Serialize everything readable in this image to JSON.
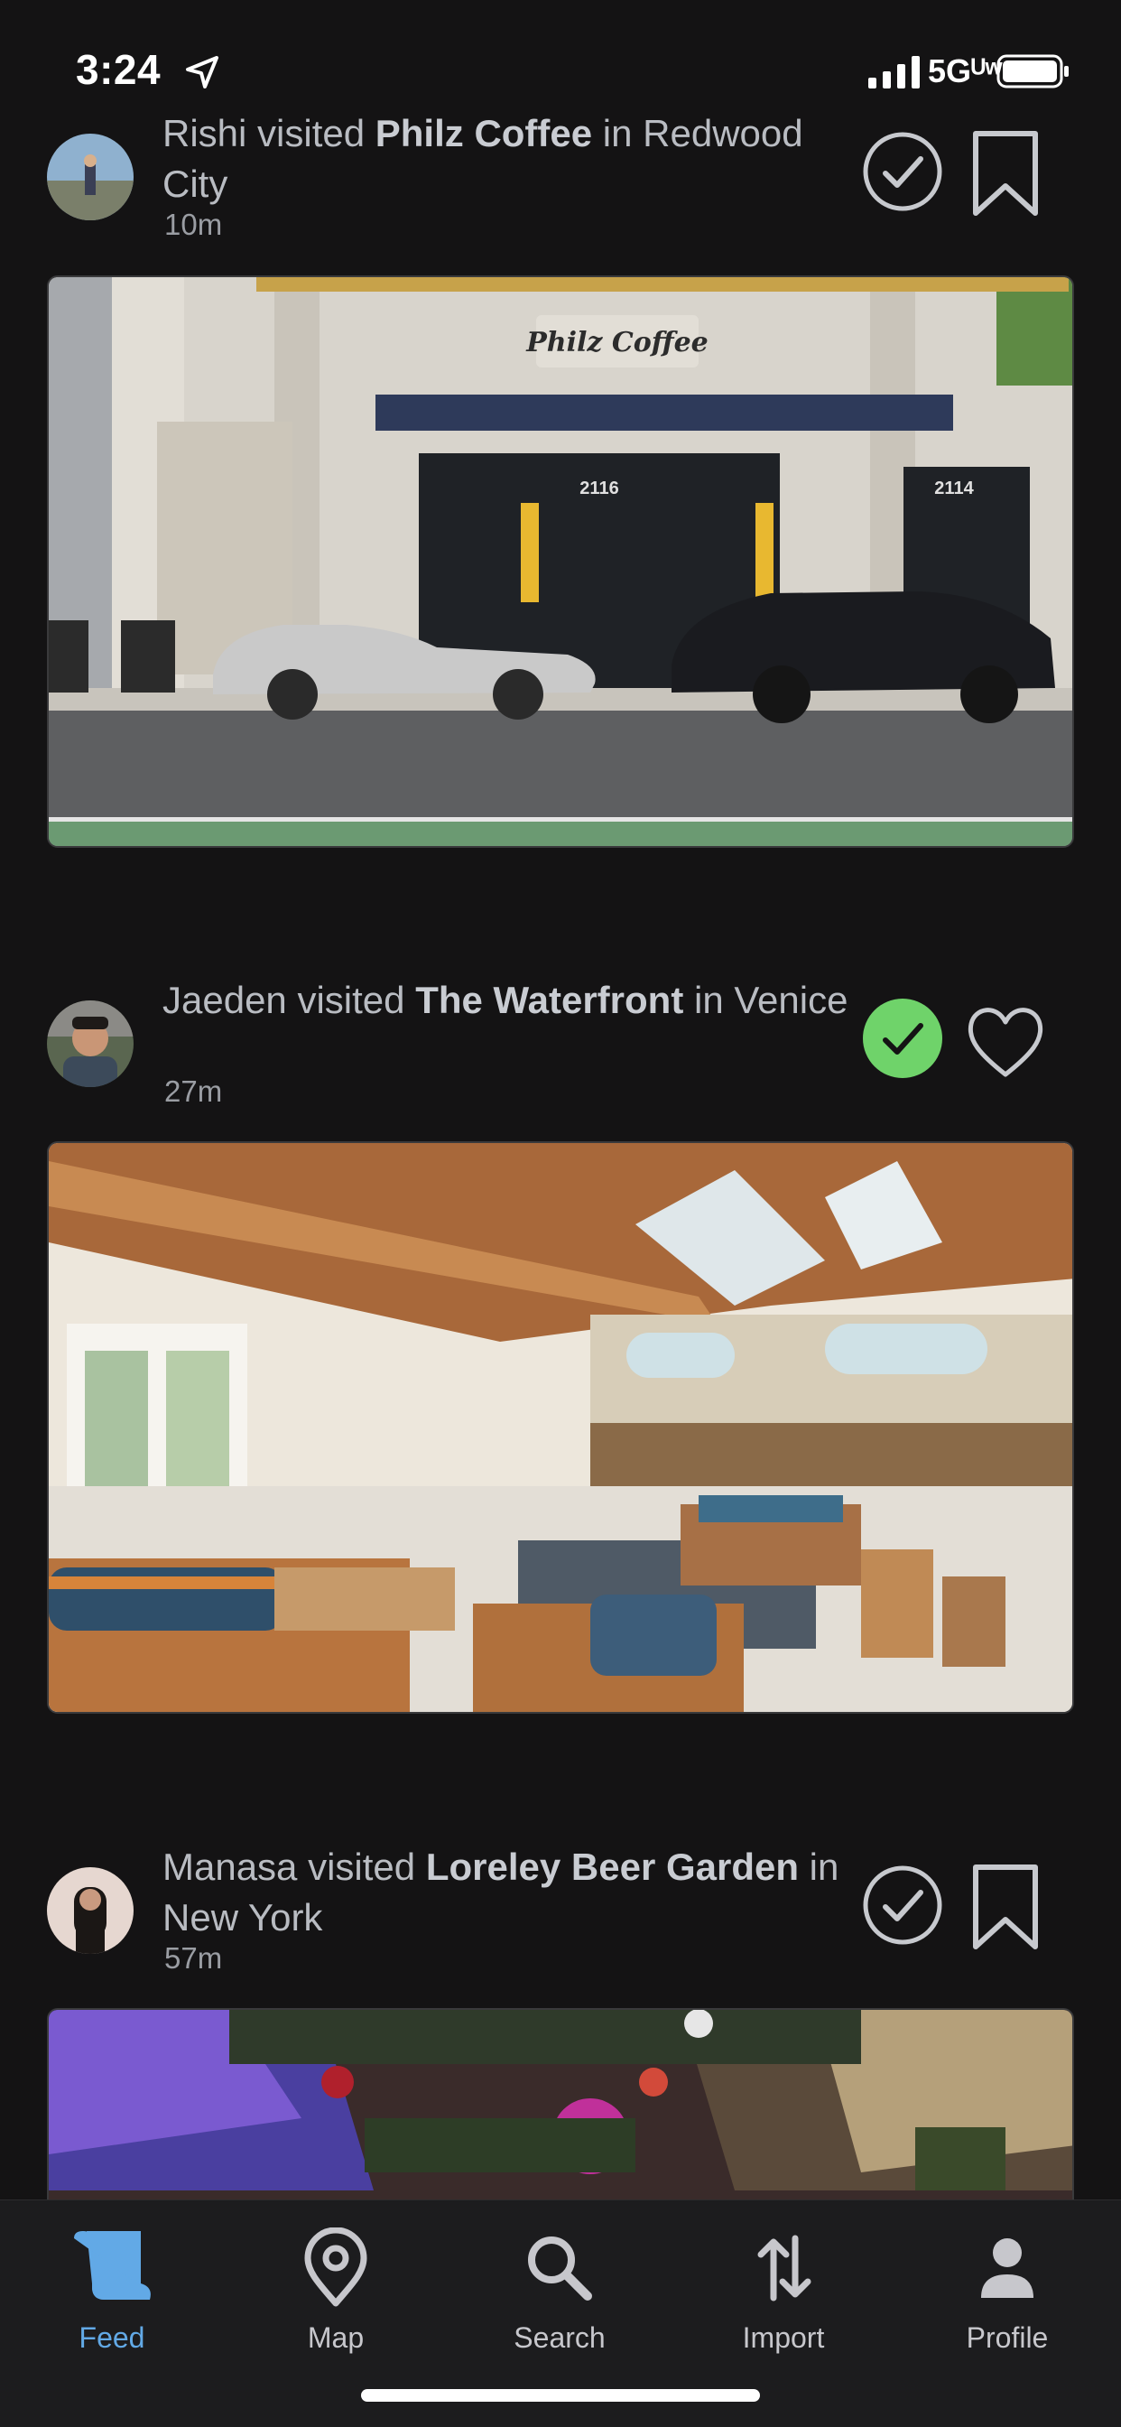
{
  "status_bar": {
    "time": "3:24",
    "network": "5Gᵁʷ"
  },
  "feed": {
    "posts": [
      {
        "user": "Rishi",
        "verb": "visited",
        "place": "Philz Coffee",
        "location": "Redwood City",
        "time_ago": "10m",
        "visited": false,
        "action_icon": "bookmark-icon",
        "photo_sign": "Philz Coffee",
        "address_left": "2116",
        "address_right": "2114"
      },
      {
        "user": "Jaeden",
        "verb": "visited",
        "place": "The Waterfront",
        "location": "Venice",
        "time_ago": "27m",
        "visited": true,
        "action_icon": "heart-icon"
      },
      {
        "user": "Manasa",
        "verb": "visited",
        "place": "Loreley Beer Garden",
        "location": "New York",
        "time_ago": "57m",
        "visited": false,
        "action_icon": "bookmark-icon"
      }
    ],
    "connector": "in"
  },
  "tabs": [
    {
      "label": "Feed",
      "icon": "scroll-icon",
      "active": true
    },
    {
      "label": "Map",
      "icon": "map-pin-icon",
      "active": false
    },
    {
      "label": "Search",
      "icon": "search-icon",
      "active": false
    },
    {
      "label": "Import",
      "icon": "import-arrows-icon",
      "active": false
    },
    {
      "label": "Profile",
      "icon": "person-icon",
      "active": false
    }
  ],
  "colors": {
    "background": "#141314",
    "visited_green": "#6fd36a",
    "active_tab": "#62a9e6"
  }
}
